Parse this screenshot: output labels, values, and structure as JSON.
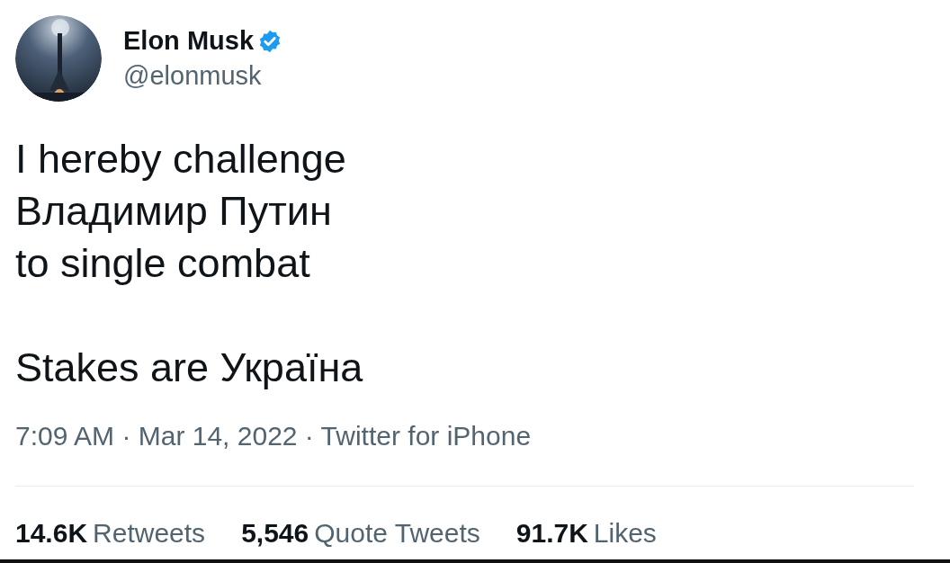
{
  "author": {
    "name": "Elon Musk",
    "verified": true,
    "handle": "@elonmusk"
  },
  "tweet": {
    "text": "I hereby challenge\nВладимир Путин\nto single combat\n\nStakes are Україна"
  },
  "meta": "7:09 AM · Mar 14, 2022 · Twitter for iPhone",
  "stats": [
    {
      "count": "14.6K",
      "label": "Retweets"
    },
    {
      "count": "5,546",
      "label": "Quote Tweets"
    },
    {
      "count": "91.7K",
      "label": "Likes"
    }
  ]
}
